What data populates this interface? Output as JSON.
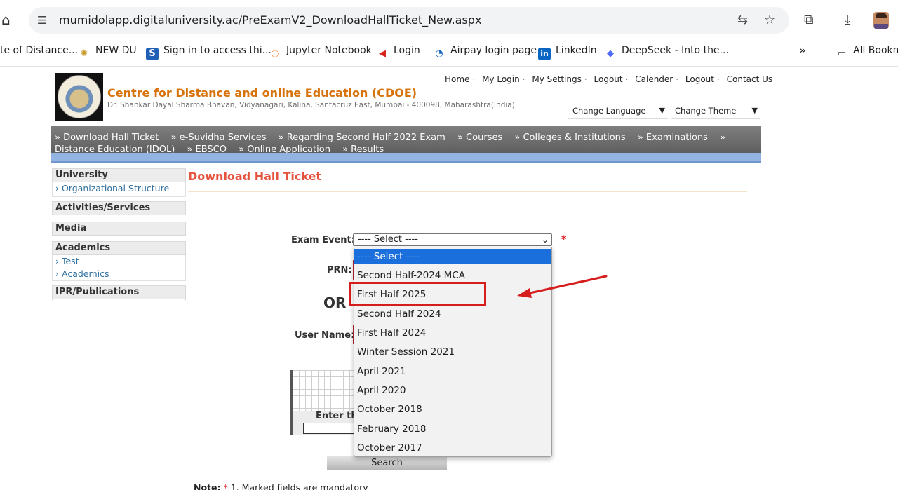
{
  "browser": {
    "url": "mumidolapp.digitaluniversity.ac/PreExamV2_DownloadHallTicket_New.aspx",
    "bookmarks": [
      {
        "label": "te of Distance...",
        "icon": "globe-icon"
      },
      {
        "label": "NEW DU",
        "icon": "gear-icon"
      },
      {
        "label": "Sign in to access thi...",
        "icon": "s-logo-icon"
      },
      {
        "label": "Jupyter Notebook",
        "icon": "jupyter-icon"
      },
      {
        "label": "Login",
        "icon": "arrow-logo-icon"
      },
      {
        "label": "Airpay login page",
        "icon": "airpay-icon"
      },
      {
        "label": "LinkedIn",
        "icon": "linkedin-icon"
      },
      {
        "label": "DeepSeek - Into the...",
        "icon": "deepseek-icon"
      },
      {
        "label": "All Bookm",
        "icon": "folder-icon"
      }
    ],
    "more_bookmarks": "»"
  },
  "header": {
    "title": "Centre for Distance and online Education (CDOE)",
    "address": "Dr. Shankar Dayal Sharma Bhavan, Vidyanagari, Kalina, Santacruz East, Mumbai - 400098, Maharashtra(India)",
    "links": [
      "Home",
      "My Login",
      "My Settings",
      "Logout",
      "Calender",
      "Logout",
      "Contact Us"
    ],
    "change_language": "Change Language",
    "change_theme": "Change Theme"
  },
  "nav": {
    "items": [
      "» Download Hall Ticket",
      "» e-Suvidha Services",
      "» Regarding Second Half 2022 Exam",
      "» Courses",
      "» Colleges & Institutions",
      "» Examinations",
      "» Distance Education (IDOL)",
      "» EBSCO",
      "» Online Application",
      "» Results"
    ]
  },
  "sidebar": {
    "sections": [
      {
        "title": "University",
        "links": [
          "Organizational Structure"
        ]
      },
      {
        "title": "Activities/Services",
        "links": []
      },
      {
        "title": "Media",
        "links": []
      },
      {
        "title": "Academics",
        "links": [
          "Test",
          "Academics"
        ]
      },
      {
        "title": "IPR/Publications",
        "links": []
      }
    ]
  },
  "main": {
    "heading": "Download Hall Ticket",
    "exam_event_label": "Exam Event:",
    "exam_event_value": "---- Select ----",
    "required_star": "*",
    "prn_label": "PRN:",
    "or_text": "OR",
    "username_label": "User Name:",
    "captcha_label": "Enter th",
    "search_button": "Search",
    "note_label": "Note:",
    "note_star": "*",
    "note_text": " 1. Marked fields are mandatory"
  },
  "dropdown": {
    "options": [
      "---- Select ----",
      "Second Half-2024 MCA",
      "First Half 2025",
      "Second Half 2024",
      "First Half 2024",
      "Winter Session 2021",
      "April 2021",
      "April 2020",
      "October 2018",
      "February 2018",
      "October 2017"
    ],
    "selected_index": 0,
    "highlighted_index": 2
  },
  "colors": {
    "accent_title": "#d8730b",
    "heading": "#e5533f",
    "selected_option": "#1a6fdc",
    "annotation": "#d61d1d"
  }
}
